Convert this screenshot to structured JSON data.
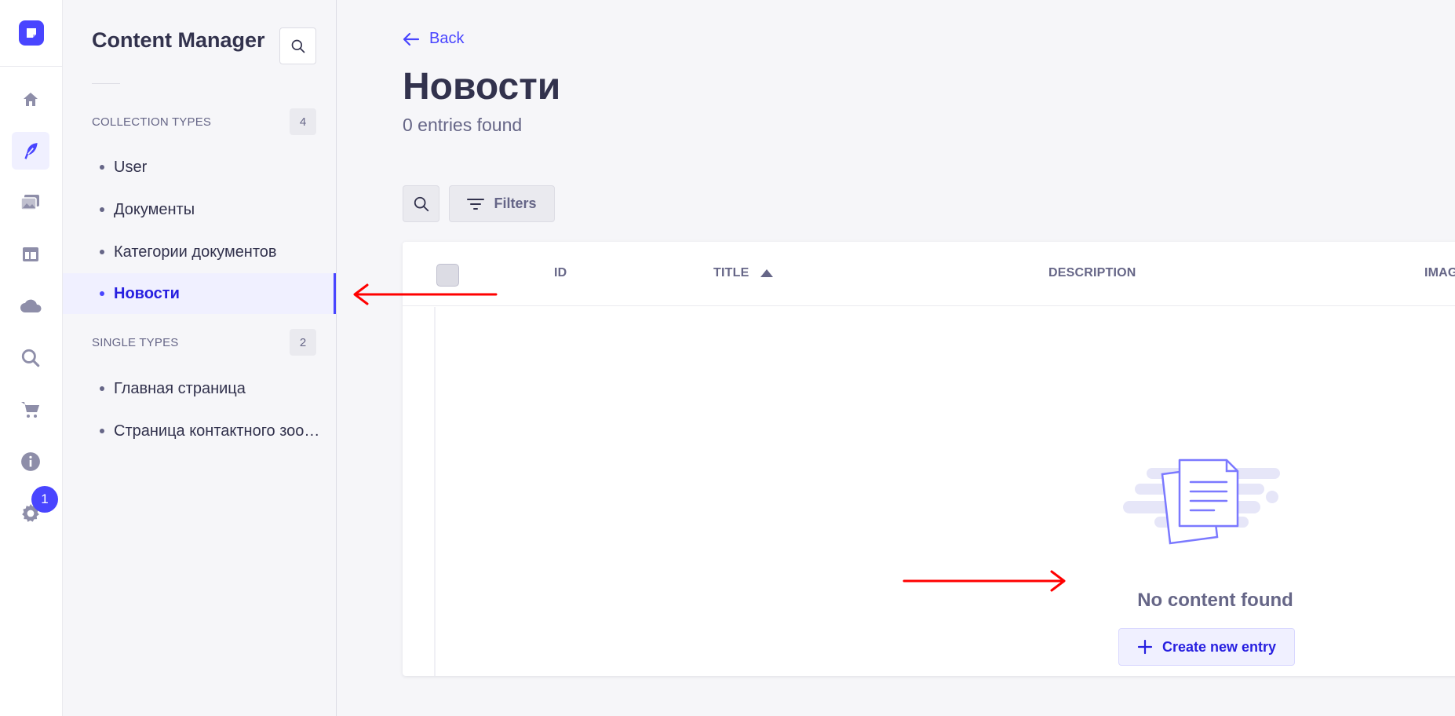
{
  "rail": {
    "icons": [
      "logo-icon",
      "home-icon",
      "feather-icon",
      "media-icon",
      "layout-icon",
      "cloud-icon",
      "search-icon",
      "cart-icon",
      "info-icon",
      "settings-icon"
    ],
    "notification_count": "1",
    "accent": "#4945ff"
  },
  "subnav": {
    "title": "Content Manager",
    "collection_section": "COLLECTION TYPES",
    "collection_count": "4",
    "collection_items": [
      {
        "label": "User"
      },
      {
        "label": "Документы"
      },
      {
        "label": "Категории документов"
      },
      {
        "label": "Новости",
        "active": true
      }
    ],
    "single_section": "SINGLE TYPES",
    "single_count": "2",
    "single_items": [
      {
        "label": "Главная страница"
      },
      {
        "label": "Страница контактного зоо…"
      }
    ]
  },
  "main": {
    "back_label": "Back",
    "title": "Новости",
    "subtitle": "0 entries found",
    "filters_label": "Filters",
    "columns": [
      "ID",
      "TITLE",
      "DESCRIPTION",
      "IMAG"
    ],
    "sort_column": "TITLE",
    "empty_text": "No content found",
    "create_label": "Create new entry"
  },
  "annotations": {
    "arrow_color": "#ff0000"
  }
}
